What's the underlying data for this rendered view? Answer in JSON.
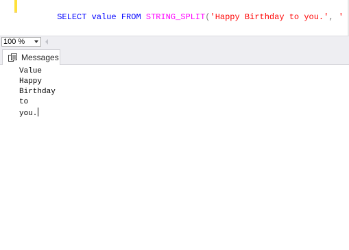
{
  "editor": {
    "query_tokens": [
      {
        "text": "SELECT",
        "kind": "kw"
      },
      {
        "text": " ",
        "kind": "plain"
      },
      {
        "text": "value",
        "kind": "kw"
      },
      {
        "text": " ",
        "kind": "plain"
      },
      {
        "text": "FROM",
        "kind": "kw"
      },
      {
        "text": " ",
        "kind": "plain"
      },
      {
        "text": "STRING_SPLIT",
        "kind": "fn"
      },
      {
        "text": "(",
        "kind": "punc"
      },
      {
        "text": "'Happy Birthday to you.'",
        "kind": "str"
      },
      {
        "text": ", ",
        "kind": "punc"
      },
      {
        "text": "' '",
        "kind": "str"
      },
      {
        "text": ");",
        "kind": "punc"
      }
    ]
  },
  "zoom": {
    "value": "100 %"
  },
  "results": {
    "tab_label": "Messages",
    "lines": [
      "Value",
      "Happy",
      "Birthday",
      "to",
      "you."
    ]
  },
  "colors": {
    "keyword": "#0000ff",
    "function": "#ff00ff",
    "string": "#ff0000",
    "punctuation": "#808080",
    "chrome_background": "#eeeef2",
    "change_marker": "#ffe13a"
  }
}
